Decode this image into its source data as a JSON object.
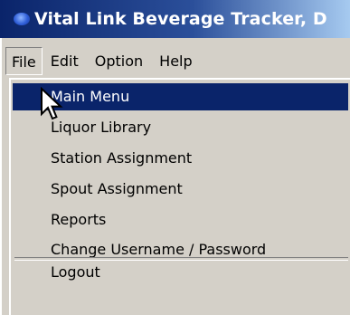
{
  "window": {
    "title": "Vital Link Beverage Tracker, D"
  },
  "menubar": {
    "items": [
      {
        "label": "File"
      },
      {
        "label": "Edit"
      },
      {
        "label": "Option"
      },
      {
        "label": "Help"
      }
    ]
  },
  "file_menu": {
    "items": [
      {
        "label": "Main Menu"
      },
      {
        "label": "Liquor Library"
      },
      {
        "label": "Station Assignment"
      },
      {
        "label": "Spout Assignment"
      },
      {
        "label": "Reports"
      },
      {
        "label": "Change Username / Password"
      },
      {
        "label": "Logout"
      }
    ]
  },
  "icons": {
    "app": "app-globe-icon",
    "cursor": "mouse-pointer-icon"
  },
  "colors": {
    "highlight": "#0a246a",
    "menu_bg": "#d4d0c8",
    "title_start": "#0a246a",
    "title_end": "#a6caf0"
  }
}
